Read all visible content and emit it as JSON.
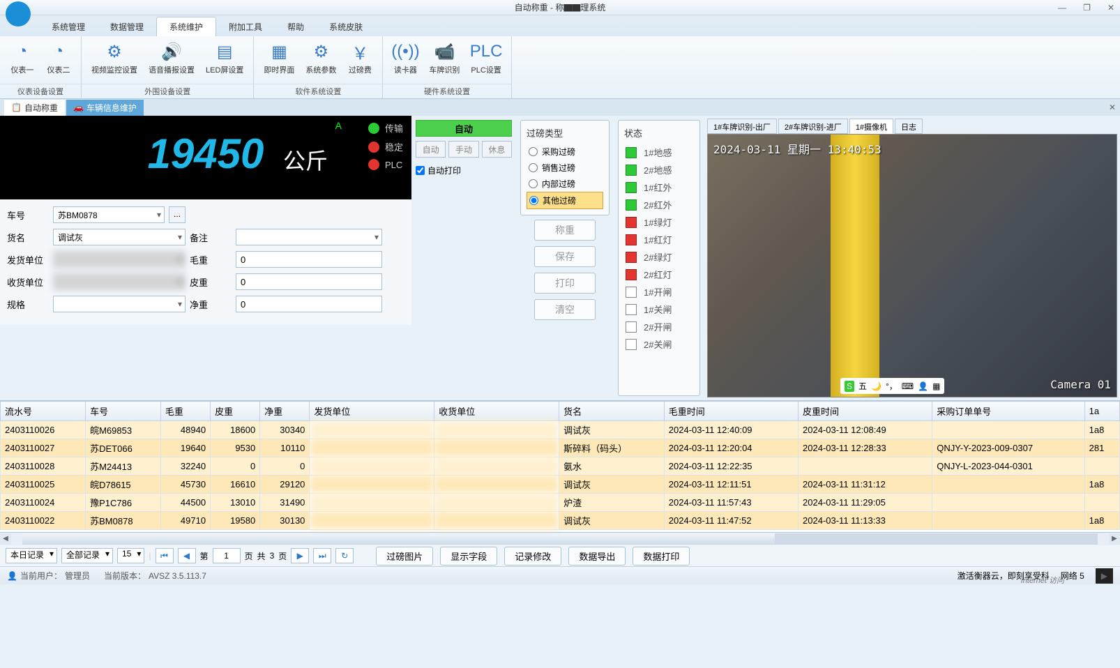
{
  "title": "自动称重 - 称▇▇理系统",
  "menu": [
    "系统管理",
    "数据管理",
    "系统维护",
    "附加工具",
    "帮助",
    "系统皮肤"
  ],
  "ribbon": {
    "groups": [
      {
        "label": "仪表设备设置",
        "btns": [
          {
            "icon": "◔",
            "label": "仪表一"
          },
          {
            "icon": "◔",
            "label": "仪表二"
          }
        ]
      },
      {
        "label": "外围设备设置",
        "btns": [
          {
            "icon": "⚙",
            "label": "视频监控设置"
          },
          {
            "icon": "🔊",
            "label": "语音播报设置"
          },
          {
            "icon": "▤",
            "label": "LED屏设置"
          }
        ]
      },
      {
        "label": "软件系统设置",
        "btns": [
          {
            "icon": "▦",
            "label": "即时界面"
          },
          {
            "icon": "⚙",
            "label": "系统参数"
          },
          {
            "icon": "￥",
            "label": "过磅费"
          }
        ]
      },
      {
        "label": "硬件系统设置",
        "btns": [
          {
            "icon": "((•))",
            "label": "读卡器"
          },
          {
            "icon": "📹",
            "label": "车牌识别"
          },
          {
            "icon": "PLC",
            "label": "PLC设置"
          }
        ]
      }
    ]
  },
  "doc_tabs": [
    {
      "icon": "📋",
      "label": "自动称重",
      "active": true
    },
    {
      "icon": "🚗",
      "label": "车辆信息维护",
      "active": false
    }
  ],
  "display": {
    "weight": "19450",
    "unit": "公斤",
    "marker": "A",
    "lights": [
      {
        "color": "green",
        "label": "传输"
      },
      {
        "color": "red",
        "label": "稳定"
      },
      {
        "color": "red",
        "label": "PLC"
      }
    ]
  },
  "auto": {
    "btn": "自动",
    "modes": [
      "自动",
      "手动",
      "休息"
    ],
    "chk": "自动打印"
  },
  "form": {
    "labels": {
      "car": "车号",
      "goods": "货名",
      "send": "发货单位",
      "recv": "收货单位",
      "spec": "规格",
      "remark": "备注",
      "gross": "毛重",
      "tare": "皮重",
      "net": "净重"
    },
    "values": {
      "car": "苏BM0878",
      "goods": "调试灰",
      "send": "",
      "recv": "",
      "spec": "",
      "remark": "",
      "gross": "0",
      "tare": "0",
      "net": "0"
    }
  },
  "weigh_type": {
    "title": "过磅类型",
    "options": [
      "采购过磅",
      "销售过磅",
      "内部过磅",
      "其他过磅"
    ],
    "selected": 3
  },
  "actions": [
    "称重",
    "保存",
    "打印",
    "清空"
  ],
  "status": {
    "title": "状态",
    "items": [
      {
        "sq": "on",
        "label": "1#地感"
      },
      {
        "sq": "on",
        "label": "2#地感"
      },
      {
        "sq": "on",
        "label": "1#红外"
      },
      {
        "sq": "on",
        "label": "2#红外"
      },
      {
        "sq": "red",
        "label": "1#绿灯"
      },
      {
        "sq": "red",
        "label": "1#红灯"
      },
      {
        "sq": "red",
        "label": "2#绿灯"
      },
      {
        "sq": "red",
        "label": "2#红灯"
      },
      {
        "sq": "off",
        "label": "1#开闸"
      },
      {
        "sq": "off",
        "label": "1#关闸"
      },
      {
        "sq": "off",
        "label": "2#开闸"
      },
      {
        "sq": "off",
        "label": "2#关闸"
      }
    ]
  },
  "camera": {
    "tabs": [
      "1#车牌识别-出厂",
      "2#车牌识别-进厂",
      "1#摄像机",
      "日志"
    ],
    "active": 2,
    "timestamp": "2024-03-11 星期一 13:40:53",
    "label": "Camera 01",
    "ime": "五"
  },
  "grid": {
    "headers": [
      "流水号",
      "车号",
      "毛重",
      "皮重",
      "净重",
      "发货单位",
      "收货单位",
      "货名",
      "毛重时间",
      "皮重时间",
      "采购订单单号",
      "1a"
    ],
    "rows": [
      [
        "2403110026",
        "皖M69853",
        "48940",
        "18600",
        "30340",
        "",
        "",
        "调试灰",
        "2024-03-11 12:40:09",
        "2024-03-11 12:08:49",
        "",
        "1a8"
      ],
      [
        "2403110027",
        "苏DET066",
        "19640",
        "9530",
        "10110",
        "",
        "",
        "斯碎料（码头）",
        "2024-03-11 12:20:04",
        "2024-03-11 12:28:33",
        "QNJY-Y-2023-009-0307",
        "281"
      ],
      [
        "2403110028",
        "苏M24413",
        "32240",
        "0",
        "0",
        "",
        "",
        "氨水",
        "2024-03-11 12:22:35",
        "",
        "QNJY-L-2023-044-0301",
        ""
      ],
      [
        "2403110025",
        "皖D78615",
        "45730",
        "16610",
        "29120",
        "",
        "",
        "调试灰",
        "2024-03-11 12:11:51",
        "2024-03-11 11:31:12",
        "",
        "1a8"
      ],
      [
        "2403110024",
        "豫P1C786",
        "44500",
        "13010",
        "31490",
        "",
        "",
        "炉渣",
        "2024-03-11 11:57:43",
        "2024-03-11 11:29:05",
        "",
        ""
      ],
      [
        "2403110022",
        "苏BM0878",
        "49710",
        "19580",
        "30130",
        "",
        "",
        "调试灰",
        "2024-03-11 11:47:52",
        "2024-03-11 11:13:33",
        "",
        "1a8"
      ]
    ]
  },
  "pager": {
    "filter1": "本日记录",
    "filter2": "全部记录",
    "pagesize": "15",
    "page": "1",
    "page_prefix": "第",
    "page_suffix": "页",
    "total_prefix": "共",
    "total": "3",
    "total_suffix": "页",
    "actions": [
      "过磅图片",
      "显示字段",
      "记录修改",
      "数据导出",
      "数据打印"
    ]
  },
  "statusbar": {
    "user_label": "当前用户：",
    "user": "管理员",
    "ver_label": "当前版本：",
    "ver": "AVSZ 3.5.113.7",
    "act1": "激活衡器云，即刻享受科",
    "net": "网络  5",
    "ie": "Internet 访问"
  }
}
